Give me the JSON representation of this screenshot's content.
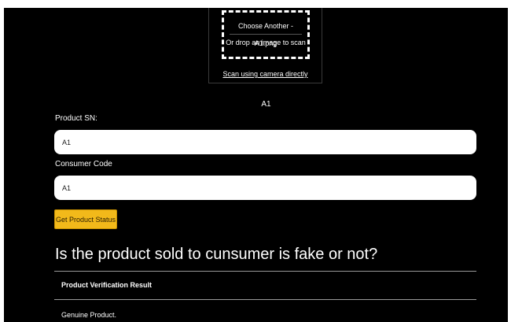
{
  "scanner": {
    "choose_label": "Choose Another - A1.png",
    "drop_text": "Or drop an image to scan",
    "camera_link": "Scan using camera directly"
  },
  "scan_result": "A1",
  "form": {
    "product_sn_label": "Product SN:",
    "product_sn_value": "A1",
    "consumer_code_label": "Consumer Code",
    "consumer_code_value": "A1",
    "submit_label": "Get Product Status"
  },
  "question": "Is the product sold to cunsumer is fake or not?",
  "result": {
    "header": "Product Verification Result",
    "value": "Genuine Product."
  },
  "colors": {
    "background": "#000000",
    "accent_button": "#f2b91a",
    "input_background": "#ffffff"
  }
}
